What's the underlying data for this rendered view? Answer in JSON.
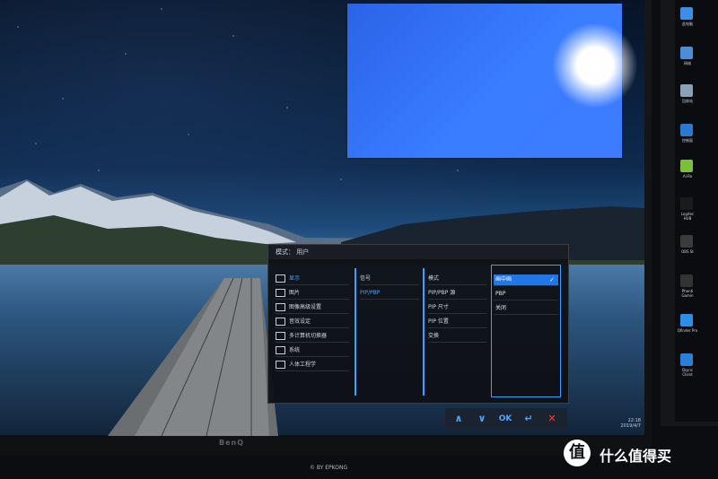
{
  "osd": {
    "header": "模式：  用户",
    "menu": [
      {
        "label": "显示",
        "active": true
      },
      {
        "label": "图片",
        "active": false
      },
      {
        "label": "图像高级设置",
        "active": false
      },
      {
        "label": "音效设定",
        "active": false
      },
      {
        "label": "多计算机切换器",
        "active": false
      },
      {
        "label": "系统",
        "active": false
      },
      {
        "label": "人体工程学",
        "active": false
      }
    ],
    "submenu1": [
      {
        "label": "信号",
        "active": false
      },
      {
        "label": "PIP/PBP",
        "active": true
      }
    ],
    "submenu2": [
      {
        "label": "模式",
        "active": false
      },
      {
        "label": "PIP/PBP 源",
        "active": false
      },
      {
        "label": "PIP 尺寸",
        "active": false
      },
      {
        "label": "PIP 位置",
        "active": false
      },
      {
        "label": "交换",
        "active": false
      }
    ],
    "options": [
      {
        "label": "画中画",
        "selected": true
      },
      {
        "label": "PBP",
        "selected": false
      },
      {
        "label": "关闭",
        "selected": false
      }
    ],
    "check_icon": "✓"
  },
  "osd_buttons": [
    {
      "label": "∧",
      "name": "up-button"
    },
    {
      "label": "∨",
      "name": "down-button"
    },
    {
      "label": "OK",
      "name": "ok-button"
    },
    {
      "label": "↵",
      "name": "back-button"
    },
    {
      "label": "✕",
      "name": "close-button"
    }
  ],
  "clock": {
    "time": "22:18",
    "date": "2019/4/7"
  },
  "brand": "BenQ",
  "credit": "© BY EPKONG",
  "watermark": {
    "logo": "值",
    "text": "什么值得买"
  },
  "right_desktop": [
    {
      "label": "此电脑",
      "color": "#3c8ee6"
    },
    {
      "label": "网络",
      "color": "#4a8fd6"
    },
    {
      "label": "回收站",
      "color": "#8aa2b8"
    },
    {
      "label": "控制面",
      "color": "#2b7ad0"
    },
    {
      "label": "Ai-Ro",
      "color": "#7bbf3a"
    },
    {
      "label": "Logitec HUB",
      "color": "#1b1b1b"
    },
    {
      "label": "OBS St",
      "color": "#3b3b3b"
    },
    {
      "label": "Phanti Gamin",
      "color": "#333333"
    },
    {
      "label": "Qfinder Pro",
      "color": "#2b8fe8"
    },
    {
      "label": "Qsync Client",
      "color": "#2a7fd6"
    }
  ]
}
